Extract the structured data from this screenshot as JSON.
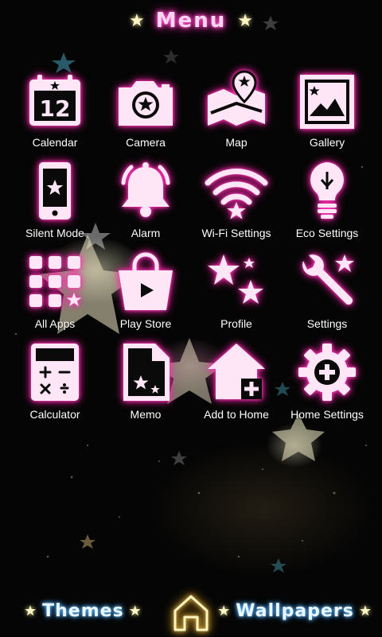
{
  "header": {
    "title": "Menu"
  },
  "apps": [
    {
      "label": "Calendar",
      "icon": "calendar-icon",
      "date": "12"
    },
    {
      "label": "Camera",
      "icon": "camera-icon"
    },
    {
      "label": "Map",
      "icon": "map-icon"
    },
    {
      "label": "Gallery",
      "icon": "gallery-icon"
    },
    {
      "label": "Silent Mode",
      "icon": "phone-icon"
    },
    {
      "label": "Alarm",
      "icon": "bell-icon"
    },
    {
      "label": "Wi-Fi Settings",
      "icon": "wifi-icon"
    },
    {
      "label": "Eco Settings",
      "icon": "lightbulb-icon"
    },
    {
      "label": "All Apps",
      "icon": "grid-icon"
    },
    {
      "label": "Play Store",
      "icon": "shopping-bag-icon"
    },
    {
      "label": "Profile",
      "icon": "stars-icon"
    },
    {
      "label": "Settings",
      "icon": "wrench-icon"
    },
    {
      "label": "Calculator",
      "icon": "calculator-icon"
    },
    {
      "label": "Memo",
      "icon": "document-icon"
    },
    {
      "label": "Add to Home",
      "icon": "house-add-icon"
    },
    {
      "label": "Home Settings",
      "icon": "gear-add-icon"
    }
  ],
  "footer": {
    "themes": "Themes",
    "wallpapers": "Wallpapers",
    "home_icon": "home-icon"
  },
  "colors": {
    "neon_pink": "#ff3fc0",
    "icon_fill": "#ffe6f6",
    "title_glow": "#ff2fb5",
    "footer_glow": "#3a9cff",
    "star": "#fff6c8",
    "background": "#050505"
  }
}
